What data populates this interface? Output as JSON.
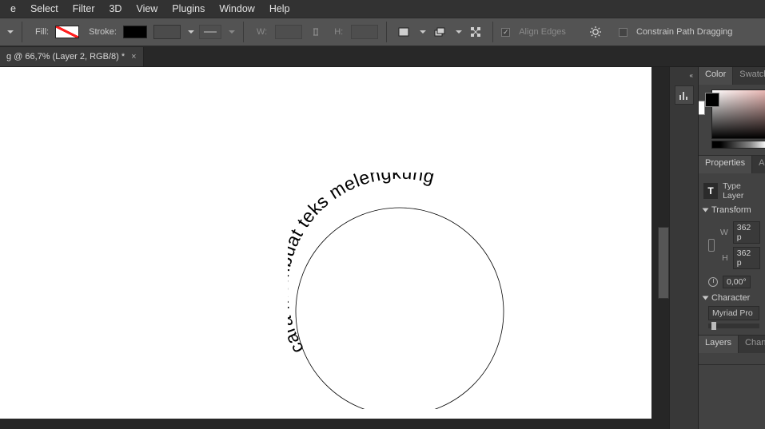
{
  "menu": {
    "items": [
      "e",
      "Select",
      "Filter",
      "3D",
      "View",
      "Plugins",
      "Window",
      "Help"
    ]
  },
  "options": {
    "fill_label": "Fill:",
    "stroke_label": "Stroke:",
    "w_label": "W:",
    "h_label": "H:",
    "align_edges_label": "Align Edges",
    "constrain_label": "Constrain Path Dragging"
  },
  "document": {
    "tab_title": "g @ 66,7% (Layer 2, RGB/8) *",
    "curved_text": "cara membuat teks melengkung"
  },
  "panels": {
    "color": {
      "tab_active": "Color",
      "tab_inactive": "Swatch"
    },
    "properties": {
      "tab_active": "Properties",
      "tab_inactive": "Ac",
      "type_layer_label": "Type Layer",
      "transform_label": "Transform",
      "w_label": "W",
      "h_label": "H",
      "w_value": "362 p",
      "h_value": "362 p",
      "angle_value": "0,00°",
      "character_label": "Character",
      "font_value": "Myriad Pro"
    },
    "layers": {
      "tab_active": "Layers",
      "tab_inactive": "Chann"
    }
  }
}
